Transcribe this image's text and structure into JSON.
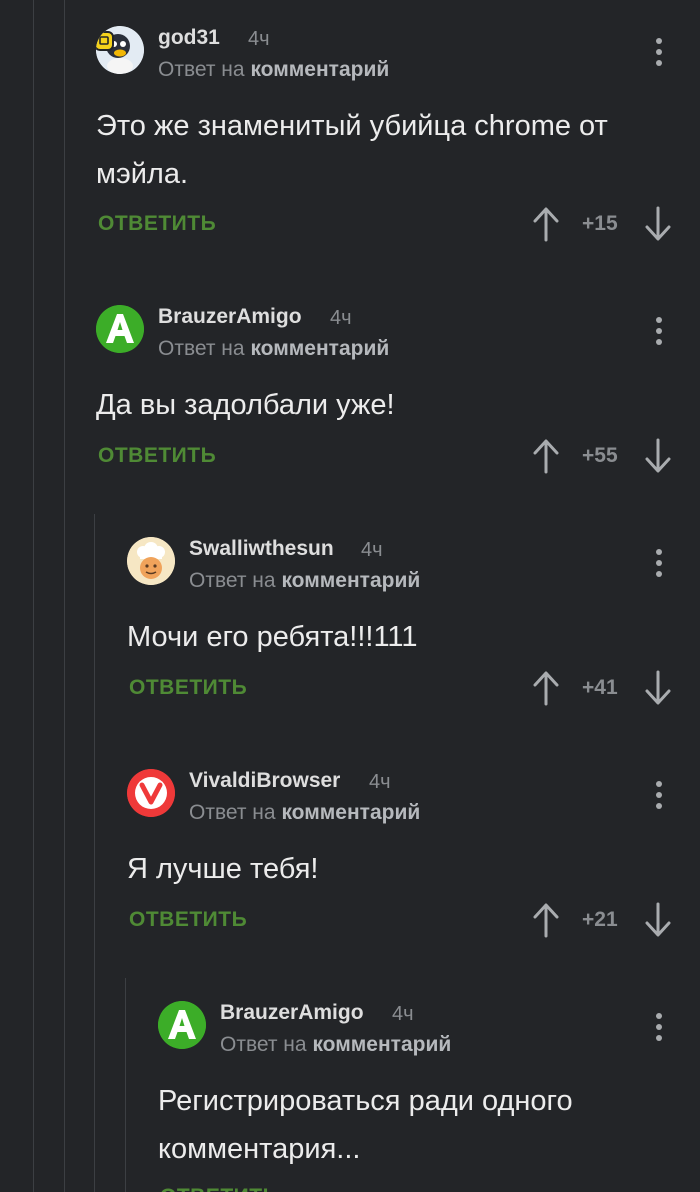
{
  "reply_prefix": "Ответ на",
  "reply_target": "комментарий",
  "reply_button": "ОТВЕТИТЬ",
  "comments": [
    {
      "author": "god31",
      "time": "4ч",
      "text": "Это же знаменитый убийца chrome от мэйла.",
      "score": "+15",
      "avatar": "penguin-avatar"
    },
    {
      "author": "BrauzerAmigo",
      "time": "4ч",
      "text": "Да вы задолбали уже!",
      "score": "+55",
      "avatar": "amigo-logo"
    },
    {
      "author": "Swalliwthesun",
      "time": "4ч",
      "text": "Мочи его ребята!!!111",
      "score": "+41",
      "avatar": "chef-avatar"
    },
    {
      "author": "VivaldiBrowser",
      "time": "4ч",
      "text": "Я лучше тебя!",
      "score": "+21",
      "avatar": "vivaldi-logo"
    },
    {
      "author": "BrauzerAmigo",
      "time": "4ч",
      "text": "Регистрироваться ради одного комментария...",
      "score": "",
      "avatar": "amigo-logo"
    }
  ],
  "colors": {
    "background": "#232528",
    "accent": "#4f8a35",
    "muted": "#8a8d91"
  }
}
